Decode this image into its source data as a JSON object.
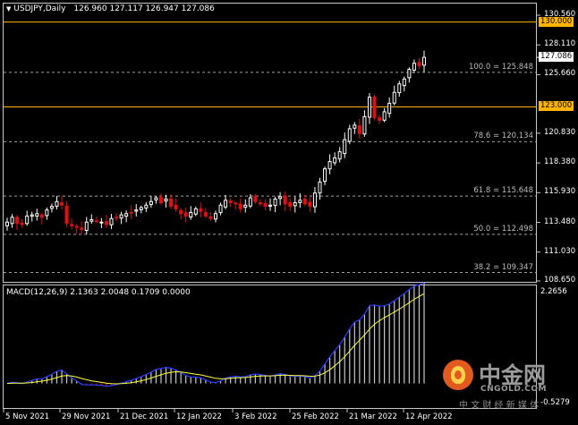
{
  "header": {
    "symbol_label": "USDJPY,Daily",
    "ohlc": "126.960 127.117 126.947 127.086"
  },
  "macd": {
    "label": "MACD(12,26,9) 2.1363 2.0048 0.1709 0.0000",
    "axis_top": "2.2656",
    "axis_bottom": "-0.5279",
    "colors": {
      "histogram": "#c8c8c8",
      "histogram_neg": "#e01010",
      "macd_line": "#2a3cff",
      "signal_line": "#ffff40"
    }
  },
  "price_axis": {
    "ticks": [
      "130.560",
      "128.110",
      "125.660",
      "120.830",
      "118.380",
      "115.930",
      "113.480",
      "111.030",
      "108.650"
    ],
    "current_price": "127.086"
  },
  "levels": {
    "resistance": "130.000",
    "support": "123.000",
    "color": "#ffb400"
  },
  "fibonacci": [
    {
      "label": "100.0 = 125.848",
      "price": 125.848
    },
    {
      "label": "78.6 = 120.134",
      "price": 120.134
    },
    {
      "label": "61.8 = 115.648",
      "price": 115.648
    },
    {
      "label": "50.0 = 112.498",
      "price": 112.498
    },
    {
      "label": "38.2 = 109.347",
      "price": 109.347
    }
  ],
  "time_axis": [
    "5 Nov 2021",
    "29 Nov 2021",
    "21 Dec 2021",
    "12 Jan 2022",
    "3 Feb 2022",
    "25 Feb 2022",
    "21 Mar 2022",
    "12 Apr 2022"
  ],
  "watermark": {
    "brand": "中金网",
    "domain": "CNGOLD.COM",
    "tagline": "中 文 财 经 新 媒 体"
  },
  "colors": {
    "bull": "#ffffff",
    "bear": "#e01010",
    "fib_line": "#a0a0a0"
  },
  "chart_data": {
    "type": "candlestick",
    "x_range": [
      "5 Nov 2021",
      "19 Apr 2022"
    ],
    "y_range": [
      108.65,
      130.56
    ],
    "close_series": [
      113.5,
      113.9,
      113.4,
      113.3,
      114.0,
      114.1,
      114.2,
      113.9,
      114.5,
      114.8,
      115.2,
      114.9,
      113.4,
      113.2,
      113.1,
      112.9,
      113.5,
      113.7,
      113.6,
      113.5,
      113.3,
      113.8,
      113.9,
      114.1,
      114.2,
      114.3,
      114.5,
      114.7,
      114.9,
      115.2,
      115.5,
      115.1,
      115.4,
      114.8,
      114.6,
      114.2,
      114.0,
      114.3,
      114.6,
      114.4,
      114.0,
      113.8,
      114.2,
      114.9,
      115.3,
      115.1,
      115.0,
      114.6,
      114.9,
      115.5,
      115.2,
      115.0,
      114.8,
      114.9,
      115.4,
      115.6,
      115.0,
      114.8,
      115.1,
      115.3,
      115.0,
      114.8,
      115.9,
      116.8,
      117.9,
      118.5,
      118.8,
      119.3,
      120.3,
      121.2,
      121.5,
      120.8,
      122.2,
      123.8,
      122.1,
      121.9,
      122.6,
      123.3,
      124.2,
      124.9,
      125.3,
      126.1,
      126.6,
      126.4,
      127.086
    ]
  }
}
